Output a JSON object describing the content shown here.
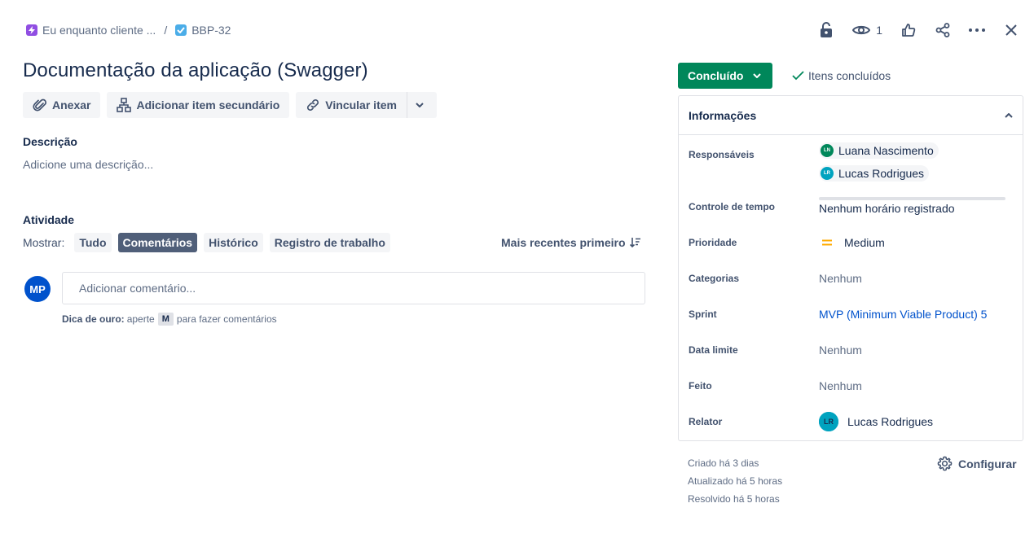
{
  "breadcrumb": {
    "parent_label": "Eu enquanto cliente ...",
    "separator": "/",
    "issue_key": "BBP-32"
  },
  "top_actions": {
    "watch_count": "1"
  },
  "issue": {
    "title": "Documentação da aplicação (Swagger)"
  },
  "actions": {
    "attach": "Anexar",
    "add_child": "Adicionar item secundário",
    "link_item": "Vincular item"
  },
  "description": {
    "label": "Descrição",
    "placeholder": "Adicione uma descrição..."
  },
  "activity": {
    "label": "Atividade",
    "show_label": "Mostrar:",
    "filters": [
      "Tudo",
      "Comentários",
      "Histórico",
      "Registro de trabalho"
    ],
    "active_filter": "Comentários",
    "sort_label": "Mais recentes primeiro"
  },
  "comment": {
    "avatar_initials": "MP",
    "placeholder": "Adicionar comentário...",
    "protip_bold": "Dica de ouro:",
    "protip_pre": "aperte",
    "protip_key": "M",
    "protip_post": "para fazer comentários"
  },
  "status": {
    "label": "Concluído",
    "resolution": "Itens concluídos",
    "color": "#00875a"
  },
  "details": {
    "header": "Informações",
    "assignees_label": "Responsáveis",
    "assignees": [
      {
        "name": "Luana Nascimento",
        "initials": "LN"
      },
      {
        "name": "Lucas Rodrigues",
        "initials": "LR"
      }
    ],
    "time_tracking_label": "Controle de tempo",
    "time_tracking_value": "Nenhum horário registrado",
    "priority_label": "Prioridade",
    "priority_value": "Medium",
    "priority_color": "#ffab00",
    "labels_label": "Categorias",
    "labels_value": "Nenhum",
    "sprint_label": "Sprint",
    "sprint_value": "MVP (Minimum Viable Product) 5",
    "due_date_label": "Data limite",
    "due_date_value": "Nenhum",
    "done_label": "Feito",
    "done_value": "Nenhum",
    "reporter_label": "Relator",
    "reporter_name": "Lucas Rodrigues",
    "reporter_initials": "LR"
  },
  "meta": {
    "created": "Criado há 3 dias",
    "updated": "Atualizado há 5 horas",
    "resolved": "Resolvido há 5 horas",
    "configure": "Configurar"
  }
}
